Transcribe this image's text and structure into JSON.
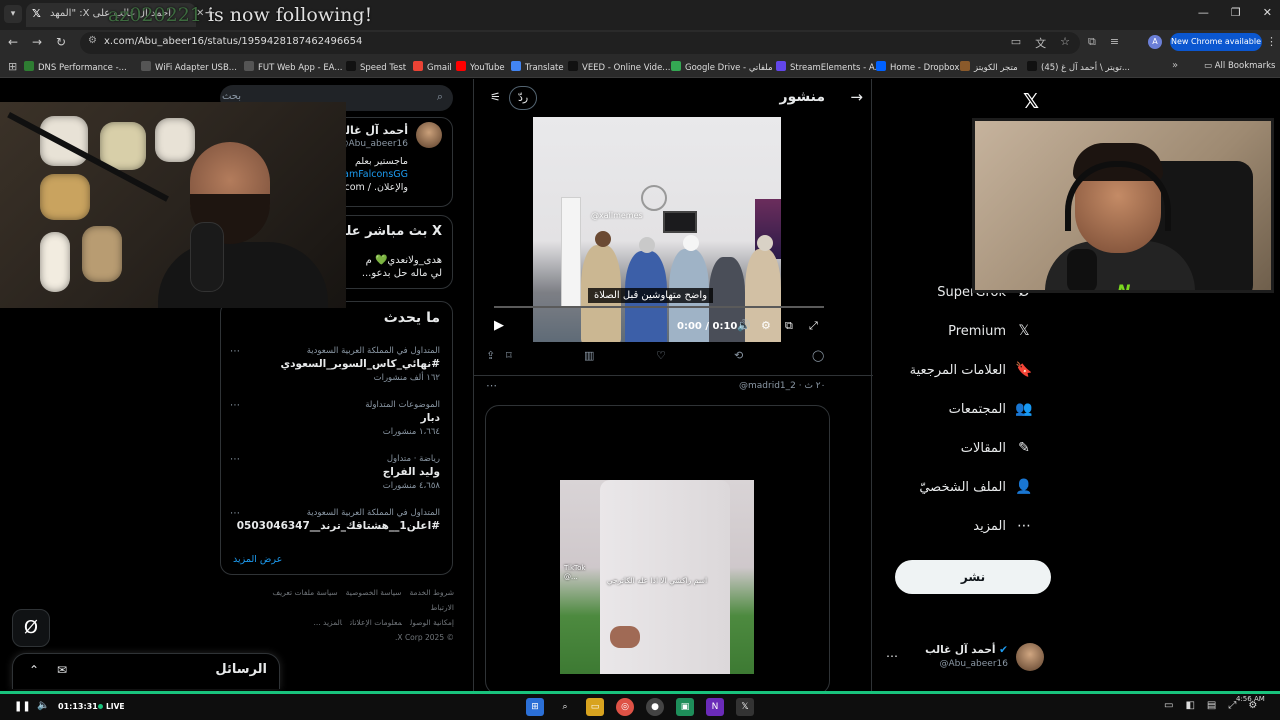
{
  "browser": {
    "tab_title": "أحمد آل غالب على X: \"المهد",
    "url": "x.com/Abu_abeer16/status/1959428187462496654",
    "new_chrome_label": "New Chrome available",
    "all_bookmarks": "All Bookmarks",
    "bookmarks": [
      {
        "label": "DNS Performance -...",
        "color": "#2e7d32"
      },
      {
        "label": "WiFi Adapter USB...",
        "color": "#555555"
      },
      {
        "label": "FUT Web App - EA...",
        "color": "#555555"
      },
      {
        "label": "Speed Test",
        "color": "#111111"
      },
      {
        "label": "Gmail",
        "color": "#ea4335"
      },
      {
        "label": "YouTube",
        "color": "#ff0000"
      },
      {
        "label": "Translate",
        "color": "#4285f4"
      },
      {
        "label": "VEED - Online Vide...",
        "color": "#111111"
      },
      {
        "label": "Google Drive - ملفاتي",
        "color": "#34a853"
      },
      {
        "label": "StreamElements - A...",
        "color": "#6246ea"
      },
      {
        "label": "Home - Dropbox",
        "color": "#0061ff"
      },
      {
        "label": "متجر الكويتز",
        "color": "#8a5a2b"
      },
      {
        "label": "(45) تويتر \\ أحمد آل غ...",
        "color": "#111111"
      }
    ]
  },
  "overlay": {
    "follow_user": "az020221",
    "follow_text": " is now following!"
  },
  "main": {
    "header_title": "منشور",
    "reply_chip": "ردّ",
    "video1": {
      "watermark": "@xallmemes",
      "caption": "واضح متهاوشين قبل الصلاة",
      "time": "0:00 / 0:10",
      "progress": 0
    },
    "reply": {
      "meta": "@madrid1_2 · ٢٠ ث"
    },
    "video2": {
      "tiktok_label": "TikTok",
      "tiktok_handle": "@...",
      "caption": "اسم راكشي الا اذا عله الكاترجي"
    }
  },
  "left": {
    "search_placeholder": "بحث",
    "profile": {
      "name": "أحمد آل غالب",
      "handle": "@Abu_abeer16",
      "bio_line1": "ماجستير بعلم",
      "bio_line2": "amFalconsGG",
      "bio_line3": "والإعلان. / com."
    },
    "live": {
      "title": "X بث مباشر على",
      "line1": "هدى_ولانعدي💚 م",
      "line2": "لي ماله حل بدعو..."
    },
    "trends_title": "ما يحدث",
    "trends": [
      {
        "context": "المتداول في المملكة العربية السعودية",
        "name": "#نهائي_كاس_السوبر_السعودي",
        "count": "١٦٢ ألف منشورات"
      },
      {
        "context": "الموضوعات المتداولة",
        "name": "دبار",
        "count": "١،٦٦٤ منشورات"
      },
      {
        "context": "رياضة · متداول",
        "name": "وليد الفراج",
        "count": "٤،٦٥٨ منشورات"
      },
      {
        "context": "المتداول في المملكة العربية السعودية",
        "name": "#اعلن1__هشتاقك_ترند__0503046347",
        "count": ""
      }
    ],
    "show_more": "عرض المزيد",
    "footer_line1": [
      "شروط الخدمة",
      "سياسة الخصوصية",
      "سياسة ملفات تعريف الارتباط"
    ],
    "footer_line2": [
      "إمكانية الوصول",
      "معلومات الإعلانات",
      "المزيد ..."
    ],
    "copyright": "© 2025 X Corp."
  },
  "nav": {
    "items": [
      {
        "label": "SuperGrok",
        "icon": "grok-icon",
        "glyph": "Ø"
      },
      {
        "label": "Premium",
        "icon": "x-premium-icon",
        "glyph": "𝕏"
      },
      {
        "label": "العلامات المرجعية",
        "icon": "bookmark-icon",
        "glyph": "🔖"
      },
      {
        "label": "المجتمعات",
        "icon": "communities-icon",
        "glyph": "👥"
      },
      {
        "label": "المقالات",
        "icon": "articles-icon",
        "glyph": "✎"
      },
      {
        "label": "الملف الشخصيّ",
        "icon": "profile-icon",
        "glyph": "👤"
      },
      {
        "label": "المزيد",
        "icon": "more-icon",
        "glyph": "⋯"
      }
    ],
    "post_button": "نشر",
    "me_name": "أحمد آل غالب",
    "me_handle": "@Abu_abeer16"
  },
  "messages": {
    "title": "الرسائل"
  },
  "player": {
    "time": "01:13:31",
    "live": "LIVE",
    "clock": "4:56 AM"
  }
}
